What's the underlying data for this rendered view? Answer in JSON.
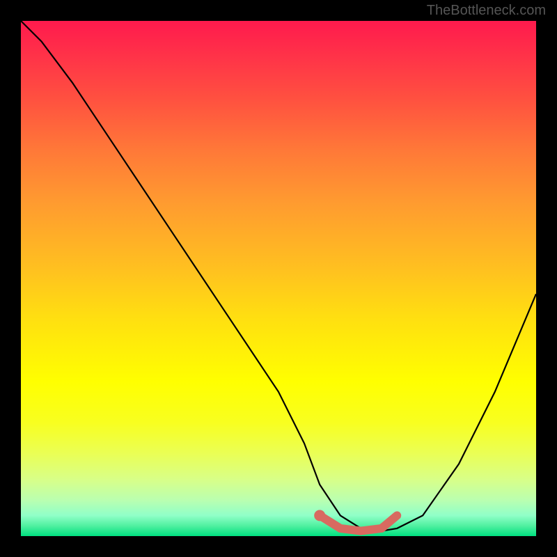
{
  "watermark": "TheBottleneck.com",
  "chart_data": {
    "type": "line",
    "title": "",
    "xlabel": "",
    "ylabel": "",
    "xlim": [
      0,
      100
    ],
    "ylim": [
      0,
      100
    ],
    "series": [
      {
        "name": "curve",
        "x": [
          0,
          4,
          10,
          20,
          30,
          40,
          50,
          55,
          58,
          62,
          66,
          70,
          73,
          78,
          85,
          92,
          100
        ],
        "y": [
          100,
          96,
          88,
          73,
          58,
          43,
          28,
          18,
          10,
          4,
          1.5,
          1,
          1.5,
          4,
          14,
          28,
          47
        ]
      }
    ],
    "highlight": {
      "name": "optimal-range",
      "x": [
        58,
        62,
        66,
        70,
        73
      ],
      "y": [
        4,
        1.5,
        1,
        1.5,
        4
      ],
      "color": "#d86a60"
    }
  }
}
